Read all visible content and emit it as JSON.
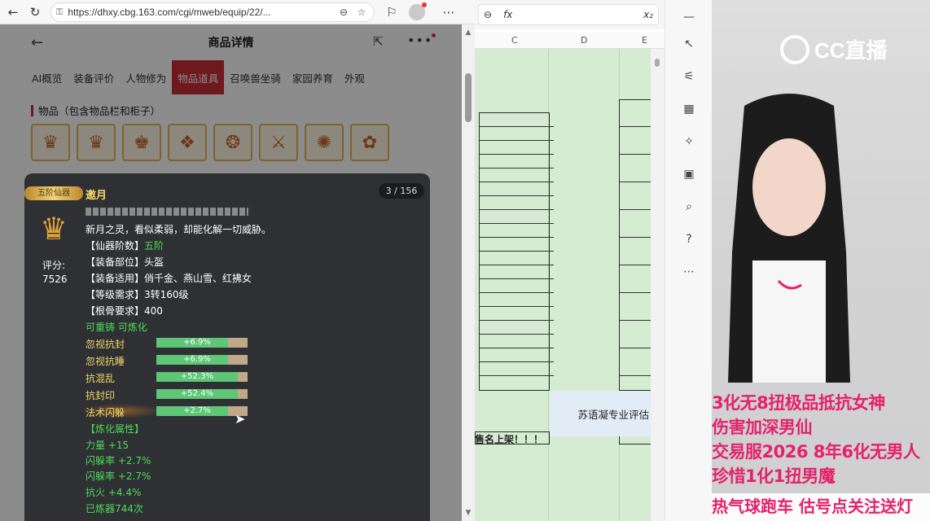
{
  "browser": {
    "url": "https://dhxy.cbg.163.com/cgi/mweb/equip/22/..."
  },
  "page": {
    "title": "商品详情",
    "tabs": [
      {
        "label": "AI概览"
      },
      {
        "label": "装备评价"
      },
      {
        "label": "人物修为"
      },
      {
        "label": "物品道具",
        "active": true
      },
      {
        "label": "召唤兽坐骑"
      },
      {
        "label": "家园养育"
      },
      {
        "label": "外观"
      }
    ],
    "section_title": "物品（包含物品栏和柜子）",
    "item_icons": [
      "helmet-icon",
      "helmet-icon",
      "crown-icon",
      "armor-icon",
      "necklace-icon",
      "weapon-icon",
      "accessory-icon",
      "lantern-icon"
    ]
  },
  "tooltip": {
    "rank_badge": "五阶仙器",
    "name": "邀月",
    "counter": "3 / 156",
    "score_label": "评分:",
    "score_value": "7526",
    "description": "新月之灵，看似柔弱，却能化解一切威胁。",
    "attrs": [
      {
        "key": "【仙器阶数】",
        "value": "五阶",
        "value_color": "#4ddb5a"
      },
      {
        "key": "【装备部位】",
        "value": "头盔"
      },
      {
        "key": "【装备适用】",
        "value": "俏千金、燕山雪、红拂女"
      },
      {
        "key": "【等级需求】",
        "value": "3转160级"
      },
      {
        "key": "【根骨要求】",
        "value": "400"
      }
    ],
    "refine_status": "可重铸 可炼化",
    "bars": [
      {
        "label": "忽视抗封",
        "text": "+6.9%",
        "fill": 0.88
      },
      {
        "label": "忽视抗睡",
        "text": "+6.9%",
        "fill": 0.88
      },
      {
        "label": "抗混乱",
        "text": "+52.3%",
        "fill": 1.0
      },
      {
        "label": "抗封印",
        "text": "+52.4%",
        "fill": 1.0
      },
      {
        "label": "法术闪躲",
        "text": "+2.7%",
        "fill": 0.88
      }
    ],
    "refine_title": "【炼化属性】",
    "refine_attrs": [
      "力量 +15",
      "闪躲率 +2.7%",
      "闪躲率 +2.7%",
      "抗火 +4.4%"
    ],
    "refine_count": "已炼器744次"
  },
  "sheet": {
    "columns": [
      "C",
      "D",
      "E"
    ],
    "eval_cell": "苏语凝专业评估",
    "notice_cell": "售名上架！！！"
  },
  "stream": {
    "logo_text": "CC直播",
    "scroll_lines": [
      "3化无8扭极品抵抗女神",
      "伤害加深男仙",
      "交易服2026 8年6化无男人",
      "珍惜1化1扭男魔"
    ],
    "ticker": "热气球跑车    估号点关注送灯"
  }
}
